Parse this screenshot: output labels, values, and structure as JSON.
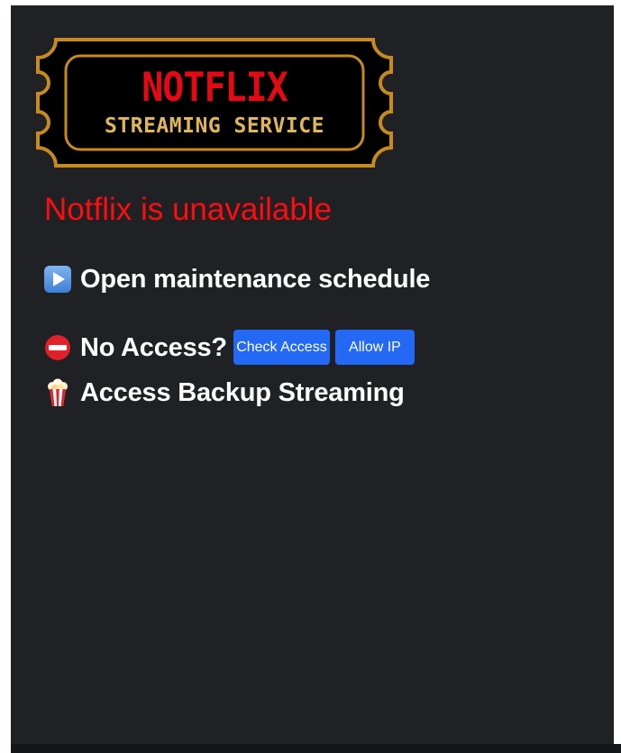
{
  "logo": {
    "title": "NOTFLIX",
    "subtitle": "STREAMING SERVICE",
    "colors": {
      "ticket_fill": "#000000",
      "ticket_border": "#c88a1c",
      "title_color": "#e50914",
      "subtitle_color": "#e0b65a"
    }
  },
  "headline": "Notflix is unavailable",
  "colors": {
    "background": "#1f2125",
    "headline": "#ff0d0d",
    "text": "#ffffff",
    "button": "#2469f5"
  },
  "items": {
    "maintenance": {
      "icon": "play-button-icon",
      "label": "Open maintenance schedule"
    },
    "access": {
      "icon": "no-entry-icon",
      "label": "No Access?",
      "check_button": "Check Access",
      "allow_button": "Allow IP"
    },
    "backup": {
      "icon": "popcorn-icon",
      "label": "Access Backup Streaming"
    }
  }
}
